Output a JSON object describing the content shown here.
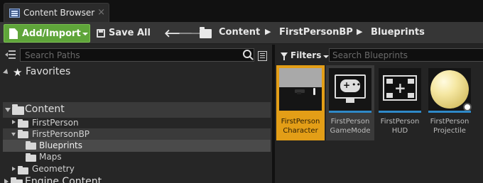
{
  "tab": {
    "title": "Content Browser",
    "close": "×"
  },
  "toolbar": {
    "add_import_label": "Add/Import",
    "save_all_label": "Save All",
    "breadcrumb": [
      "Content",
      "FirstPersonBP",
      "Blueprints"
    ],
    "breadcrumb_sep": "▶",
    "back_arrow": "🡐",
    "forward_arrow": "🡒"
  },
  "sources": {
    "search_placeholder": "Search Paths",
    "favorites_label": "Favorites",
    "tree": {
      "content": "Content",
      "first_person": "FirstPerson",
      "first_person_bp": "FirstPersonBP",
      "blueprints": "Blueprints",
      "maps": "Maps",
      "geometry": "Geometry",
      "engine_content": "Engine Content"
    },
    "selected_folder": "Blueprints"
  },
  "assets": {
    "filters_label": "Filters",
    "search_placeholder": "Search Blueprints",
    "items": [
      {
        "line1": "FirstPerson",
        "line2": "Character",
        "icon": "character-thumbnail",
        "selected": true
      },
      {
        "line1": "FirstPerson",
        "line2": "GameMode",
        "icon": "gamepad-monitor-icon",
        "selected": false
      },
      {
        "line1": "FirstPerson",
        "line2": "HUD",
        "icon": "hud-icon",
        "selected": false
      },
      {
        "line1": "FirstPerson",
        "line2": "Projectile",
        "icon": "sphere-thumbnail",
        "selected": false
      }
    ]
  },
  "colors": {
    "accent_green": "#5fa53a",
    "selection_orange": "#e39e17",
    "asset_bar_blue": "#2e89c8"
  }
}
